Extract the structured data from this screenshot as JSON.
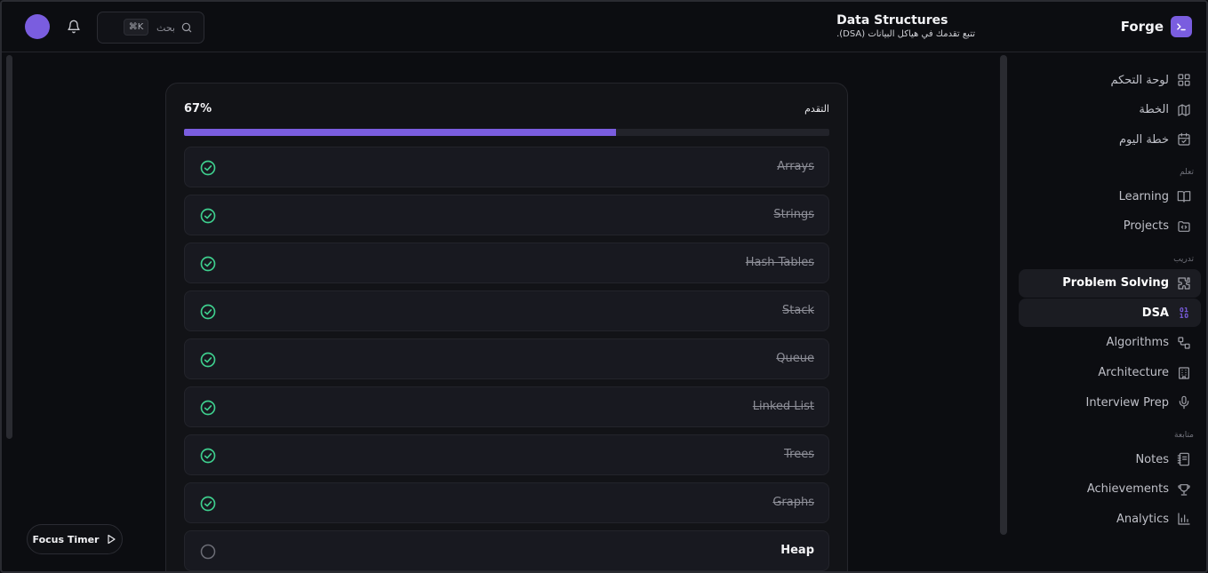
{
  "header": {
    "brand": "Forge",
    "title": "Data Structures",
    "subtitle": "تتبع تقدمك في هياكل البيانات (DSA).",
    "search_placeholder": "بحث",
    "search_shortcut": "⌘K"
  },
  "progress": {
    "label": "التقدم",
    "value_text": "67%",
    "fraction": 0.67
  },
  "topics": [
    {
      "name": "Arrays",
      "done": true
    },
    {
      "name": "Strings",
      "done": true
    },
    {
      "name": "Hash Tables",
      "done": true
    },
    {
      "name": "Stack",
      "done": true
    },
    {
      "name": "Queue",
      "done": true
    },
    {
      "name": "Linked List",
      "done": true
    },
    {
      "name": "Trees",
      "done": true
    },
    {
      "name": "Graphs",
      "done": true
    },
    {
      "name": "Heap",
      "done": false
    }
  ],
  "focus_timer": {
    "label": "Focus Timer"
  },
  "sidebar": {
    "top": [
      {
        "label": "لوحة التحكم",
        "icon": "dashboard-icon"
      },
      {
        "label": "الخطة",
        "icon": "map-icon"
      },
      {
        "label": "خطة اليوم",
        "icon": "calendar-check-icon"
      }
    ],
    "learn_title": "تعلم",
    "learn": [
      {
        "label": "Learning",
        "icon": "book-icon"
      },
      {
        "label": "Projects",
        "icon": "folder-code-icon"
      }
    ],
    "practice_title": "تدريب",
    "practice": [
      {
        "label": "Problem Solving",
        "icon": "puzzle-icon",
        "active": true
      },
      {
        "label": "DSA",
        "icon": "binary-icon",
        "active": true
      },
      {
        "label": "Algorithms",
        "icon": "flow-icon"
      },
      {
        "label": "Architecture",
        "icon": "building-icon"
      },
      {
        "label": "Interview Prep",
        "icon": "mic-icon"
      }
    ],
    "track_title": "متابعة",
    "track": [
      {
        "label": "Notes",
        "icon": "notebook-icon"
      },
      {
        "label": "Achievements",
        "icon": "trophy-icon"
      },
      {
        "label": "Analytics",
        "icon": "bar-chart-icon"
      }
    ]
  },
  "colors": {
    "accent": "#7a5ddf",
    "success": "#3ecf8e",
    "background": "#0c0d11",
    "card": "#121317"
  }
}
